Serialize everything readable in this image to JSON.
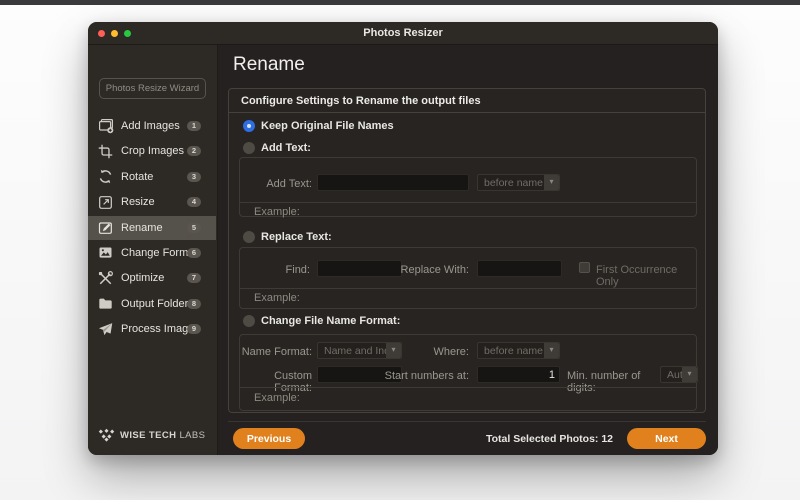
{
  "colors": {
    "accent_orange": "#e0811e",
    "radio_selected_blue": "#2e6ee2",
    "traffic_red": "#ff5f57",
    "traffic_yellow": "#febc2e",
    "traffic_green": "#28c840"
  },
  "window": {
    "title": "Photos Resizer"
  },
  "sidebar": {
    "wizard_button_label": "Photos Resize Wizard",
    "items": [
      {
        "label": "Add Images",
        "badge": "1",
        "icon": "add-images-icon"
      },
      {
        "label": "Crop Images",
        "badge": "2",
        "icon": "crop-icon"
      },
      {
        "label": "Rotate",
        "badge": "3",
        "icon": "rotate-icon"
      },
      {
        "label": "Resize",
        "badge": "4",
        "icon": "resize-icon"
      },
      {
        "label": "Rename",
        "badge": "5",
        "icon": "rename-icon"
      },
      {
        "label": "Change Format",
        "badge": "6",
        "icon": "image-format-icon"
      },
      {
        "label": "Optimize",
        "badge": "7",
        "icon": "tools-icon"
      },
      {
        "label": "Output Folder",
        "badge": "8",
        "icon": "folder-icon"
      },
      {
        "label": "Process Images",
        "badge": "9",
        "icon": "paper-plane-icon"
      }
    ],
    "logo_text_strong": "WISE TECH",
    "logo_text_light": "LABS"
  },
  "main": {
    "title": "Rename",
    "panel_header": "Configure Settings to Rename the output files",
    "keep_original": {
      "radio_label": "Keep Original File Names"
    },
    "add_text": {
      "radio_label": "Add Text:",
      "field_label": "Add Text:",
      "input_value": "",
      "position_value": "before name",
      "example_label": "Example:"
    },
    "replace_text": {
      "radio_label": "Replace Text:",
      "find_label": "Find:",
      "find_value": "",
      "replace_label": "Replace With:",
      "replace_value": "",
      "first_occurrence_label": "First Occurrence Only",
      "example_label": "Example:"
    },
    "change_format": {
      "radio_label": "Change File Name Format:",
      "name_format_label": "Name Format:",
      "name_format_value": "Name and Index",
      "where_label": "Where:",
      "where_value": "before name",
      "custom_format_label": "Custom Format:",
      "custom_format_value": "",
      "start_numbers_label": "Start numbers at:",
      "start_numbers_value": "1",
      "min_digits_label": "Min. number of digits:",
      "min_digits_value": "Auto",
      "example_label": "Example:"
    },
    "footer": {
      "previous_label": "Previous",
      "total_selected_label": "Total Selected Photos: 12",
      "next_label": "Next"
    }
  }
}
